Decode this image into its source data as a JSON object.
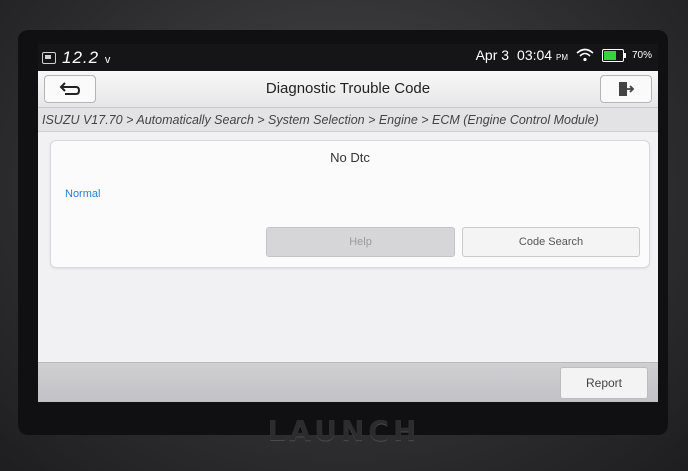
{
  "status_bar": {
    "voltage_value": "12.2",
    "voltage_unit": "v",
    "date": "Apr 3",
    "time": "03:04",
    "ampm": "PM",
    "battery_percent": "70%",
    "icons": [
      "battery-status-icon",
      "wifi-icon",
      "battery-icon"
    ]
  },
  "header": {
    "title": "Diagnostic Trouble Code",
    "back_icon": "back-arrow-icon",
    "exit_icon": "exit-icon"
  },
  "breadcrumb": "ISUZU V17.70 > Automatically Search > System Selection > Engine > ECM (Engine Control Module)",
  "dtc_panel": {
    "title": "No Dtc",
    "status": "Normal",
    "help_label": "Help",
    "code_search_label": "Code Search"
  },
  "footer": {
    "report_label": "Report"
  },
  "device_brand": "LAUNCH",
  "colors": {
    "status_text": "#2b7fd6",
    "status_bar_bg": "#151517",
    "battery_fill": "#39d23a"
  }
}
